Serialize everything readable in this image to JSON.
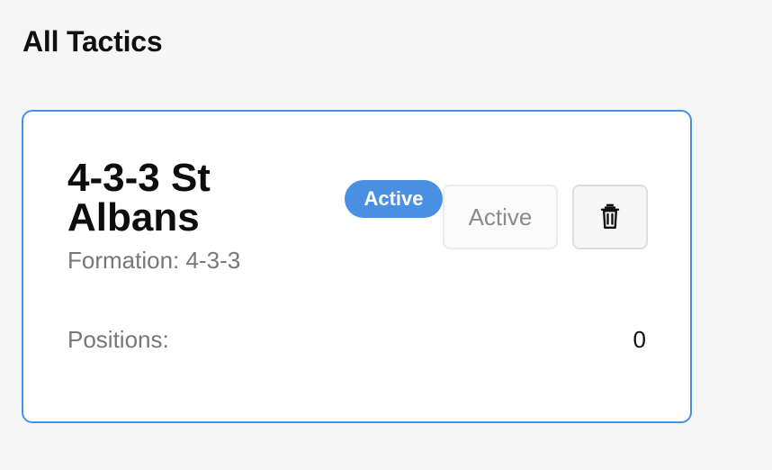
{
  "page": {
    "title": "All Tactics"
  },
  "tactic": {
    "name": "4-3-3 St Albans",
    "formation_text": "Formation: 4-3-3",
    "status_badge": "Active",
    "active_button_label": "Active",
    "delete_icon": "trash-icon",
    "positions_label": "Positions:",
    "positions_value": "0"
  },
  "colors": {
    "accent": "#4a90e2",
    "page_background": "#f6f6f6",
    "card_background": "#ffffff",
    "muted_text": "#777777"
  }
}
